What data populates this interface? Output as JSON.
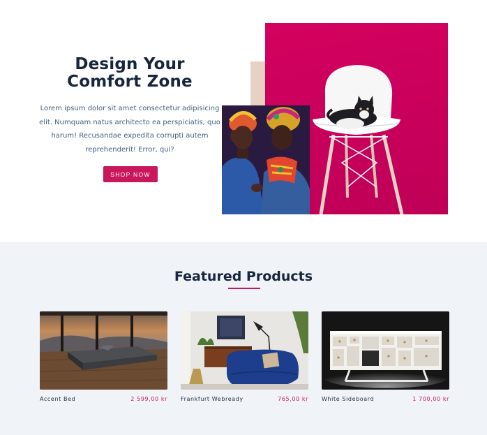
{
  "hero": {
    "title": "Design Your\nComfort Zone",
    "text": "Lorem ipsum dolor sit amet consectetur adipisicing elit. Numquam natus architecto ea perspiciatis, quo harum! Recusandae expedita corrupti autem reprehenderit! Error, qui?",
    "button_label": "SHOP NOW"
  },
  "featured": {
    "title": "Featured Products",
    "products": [
      {
        "name": "Accent Bed",
        "price": "2 599,00 kr"
      },
      {
        "name": "Frankfurt Webready",
        "price": "765,00 kr"
      },
      {
        "name": "White Sideboard",
        "price": "1 700,00 kr"
      }
    ]
  },
  "colors": {
    "accent": "#c9175c",
    "heading": "#17263e",
    "body_text": "#44607f",
    "section_bg": "#f0f3f7"
  }
}
